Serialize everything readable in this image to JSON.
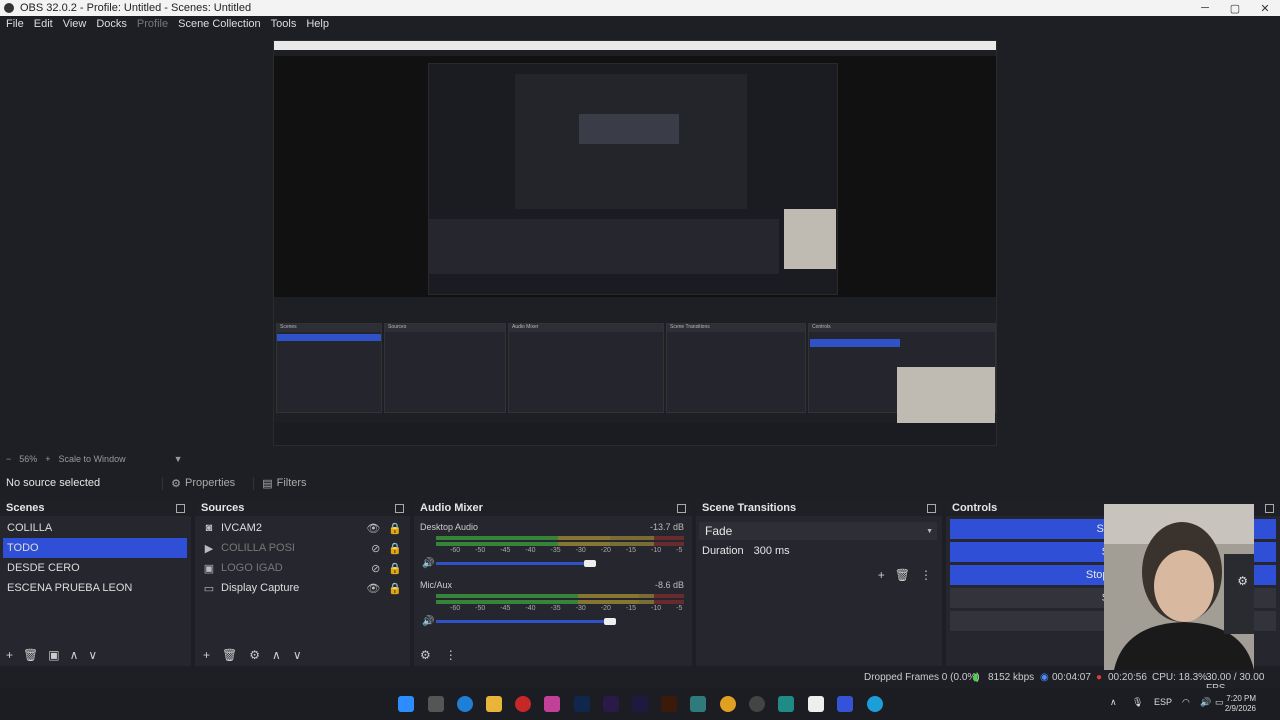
{
  "window": {
    "title": "OBS 32.0.2 - Profile: Untitled - Scenes: Untitled",
    "minimize": "─",
    "maximize": "▢",
    "close": "✕"
  },
  "menu": [
    "File",
    "Edit",
    "View",
    "Docks",
    "Profile",
    "Scene Collection",
    "Tools",
    "Help"
  ],
  "preview": {
    "zoom": "56%",
    "zoom_plus": "+",
    "scale_mode": "Scale to Window"
  },
  "source_toolbar": {
    "no_source": "No source selected",
    "properties": "Properties",
    "filters": "Filters"
  },
  "scenes": {
    "title": "Scenes",
    "items": [
      "COLILLA",
      "TODO",
      "DESDE CERO",
      "ESCENA PRUEBA LEON"
    ],
    "selected": "TODO"
  },
  "sources": {
    "title": "Sources",
    "items": [
      {
        "name": "IVCAM2",
        "icon": "camera-icon",
        "visible": true
      },
      {
        "name": "COLILLA POSI",
        "icon": "play-icon",
        "visible": false
      },
      {
        "name": "LOGO IGAD",
        "icon": "image-icon",
        "visible": false
      },
      {
        "name": "Display Capture",
        "icon": "monitor-icon",
        "visible": true
      }
    ]
  },
  "audio_mixer": {
    "title": "Audio Mixer",
    "channels": [
      {
        "name": "Desktop Audio",
        "db": "-13.7 dB",
        "level": 0.7,
        "volume": 0.62
      },
      {
        "name": "Mic/Aux",
        "db": "-8.6 dB",
        "level": 0.82,
        "volume": 0.7
      }
    ],
    "ticks": [
      "-60",
      "-50",
      "-45",
      "-40",
      "-35",
      "-30",
      "-25",
      "-20",
      "-15",
      "-10",
      "-5",
      "0"
    ]
  },
  "scene_transitions": {
    "title": "Scene Transitions",
    "transition": "Fade",
    "duration_label": "Duration",
    "duration_value": "300 ms"
  },
  "controls": {
    "title": "Controls",
    "buttons": [
      {
        "label": "Stop S",
        "style": "blue"
      },
      {
        "label": "Stop",
        "style": "blue"
      },
      {
        "label": "Stop Virtua",
        "style": "blue"
      },
      {
        "label": "Stud",
        "style": "gray"
      },
      {
        "label": "Se",
        "style": "gray"
      }
    ]
  },
  "status": {
    "dropped": "Dropped Frames 0 (0.0%)",
    "bitrate": "8152 kbps",
    "stream_time": "00:04:07",
    "rec_time": "00:20:56",
    "cpu": "CPU: 18.3%",
    "fps": "30.00 / 30.00 FPS"
  },
  "taskbar": {
    "language": "ESP",
    "time": "7:20 PM",
    "date": "2/9/2026"
  },
  "colors": {
    "accent": "#2f4fd6",
    "background": "#1e1f25",
    "dock": "#26272e"
  }
}
